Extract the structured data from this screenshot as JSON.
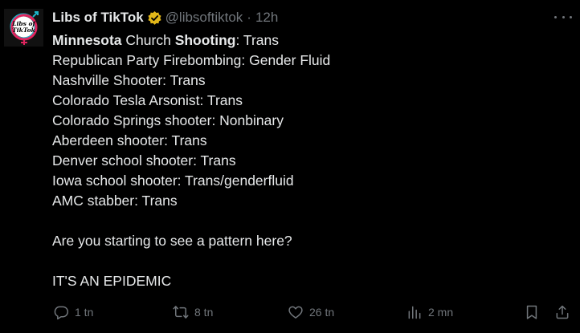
{
  "tweet": {
    "author_name": "Libs of TikTok",
    "handle": "@libsoftiktok",
    "separator": "·",
    "time": "12h",
    "avatar_text": "Libs of TikTok",
    "lines": {
      "l1a": "Minnesota",
      "l1b": " Church ",
      "l1c": "Shooting",
      "l1d": ": Trans",
      "l2": "Republican Party Firebombing: Gender Fluid",
      "l3": "Nashville Shooter: Trans",
      "l4": "Colorado Tesla Arsonist: Trans",
      "l5": "Colorado Springs shooter: Nonbinary",
      "l6": "Aberdeen shooter: Trans",
      "l7": "Denver school shooter: Trans",
      "l8": "Iowa school shooter: Trans/genderfluid",
      "l9": "AMC stabber: Trans",
      "l10": "Are you starting to see a pattern here?",
      "l11": "IT'S AN EPIDEMIC"
    }
  },
  "actions": {
    "replies": "1 tn",
    "reposts": "8 tn",
    "likes": "26 tn",
    "views": "2 mn"
  },
  "colors": {
    "background": "#000000",
    "text": "#e7e9ea",
    "secondary": "#71767b",
    "verified_badge": "#e2b719",
    "avatar_ring": "#e0245e",
    "avatar_ring_accent": "#1cb4c8"
  },
  "icons": {
    "verified": "verified-badge-icon",
    "more": "more-icon",
    "reply": "reply-icon",
    "repost": "repost-icon",
    "like": "like-icon",
    "views": "views-icon",
    "bookmark": "bookmark-icon",
    "share": "share-icon"
  }
}
